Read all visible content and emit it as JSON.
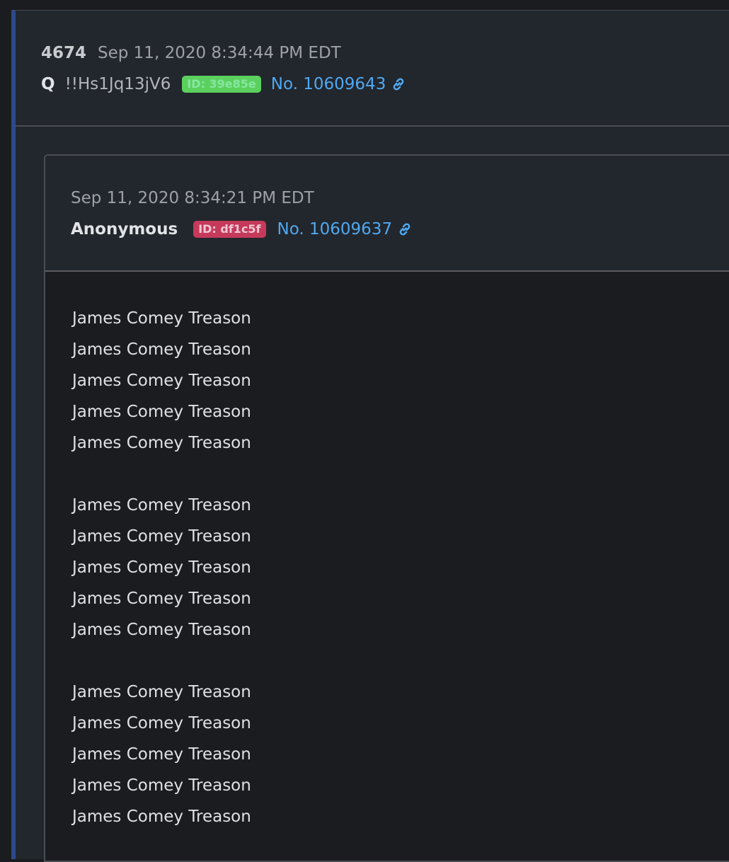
{
  "post": {
    "number": "4674",
    "date": "Sep 11, 2020 8:34:44 PM EDT",
    "author": "Q",
    "tripcode": "!!Hs1Jq13jV6",
    "id_badge": "ID: 39e85e",
    "post_link": "No. 10609643",
    "id_color": "#5bd05e"
  },
  "quoted": {
    "date": "Sep 11, 2020 8:34:21 PM EDT",
    "author": "Anonymous",
    "id_badge": "ID: df1c5f",
    "post_link": "No. 10609637",
    "id_color": "#c53a5b",
    "lines": [
      "James Comey Treason",
      "James Comey Treason",
      "James Comey Treason",
      "James Comey Treason",
      "James Comey Treason",
      "",
      "James Comey Treason",
      "James Comey Treason",
      "James Comey Treason",
      "James Comey Treason",
      "James Comey Treason",
      "",
      "James Comey Treason",
      "James Comey Treason",
      "James Comey Treason",
      "James Comey Treason",
      "James Comey Treason"
    ]
  },
  "icons": {
    "link": "link-icon"
  },
  "colors": {
    "accent_link": "#4fa9f0",
    "card_left_border": "#2c4a8a"
  }
}
